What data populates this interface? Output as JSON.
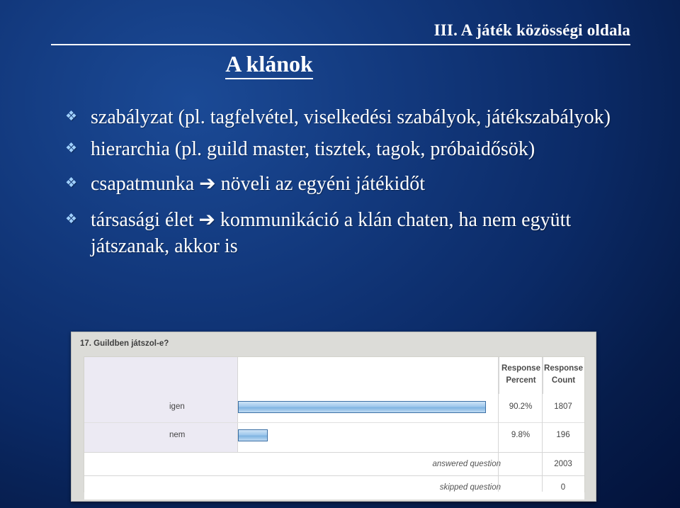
{
  "header": {
    "title": "III. A játék közösségi oldala"
  },
  "slide": {
    "title": "A klánok",
    "bullet_marker": "❖",
    "bullets": [
      "szabályzat (pl. tagfelvétel, viselkedési szabályok, játékszabályok)",
      "hierarchia (pl. guild master, tisztek, tagok, próbaidősök)",
      "csapatmunka ➔ növeli az egyéni játékidőt",
      "társasági élet ➔ kommunikáció a klán chaten, ha nem együtt játszanak, akkor is"
    ]
  },
  "survey": {
    "question": "17. Guildben játszol-e?",
    "headers": {
      "percent": "Response\nPercent",
      "percent_line1": "Response",
      "percent_line2": "Percent",
      "count_line1": "Response",
      "count_line2": "Count"
    },
    "rows": [
      {
        "label": "igen",
        "percent": "90.2%",
        "count": "1807",
        "bar_ratio": 0.902
      },
      {
        "label": "nem",
        "percent": "9.8%",
        "count": "196",
        "bar_ratio": 0.098
      }
    ],
    "footers": [
      {
        "label": "answered question",
        "value": "2003"
      },
      {
        "label": "skipped question",
        "value": "0"
      }
    ]
  },
  "chart_data": {
    "type": "bar",
    "title": "17. Guildben játszol-e?",
    "categories": [
      "igen",
      "nem"
    ],
    "values": [
      90.2,
      9.8
    ],
    "counts": [
      1807,
      196
    ],
    "xlabel": "",
    "ylabel": "Response Percent",
    "ylim": [
      0,
      100
    ],
    "answered_question": 2003,
    "skipped_question": 0
  }
}
